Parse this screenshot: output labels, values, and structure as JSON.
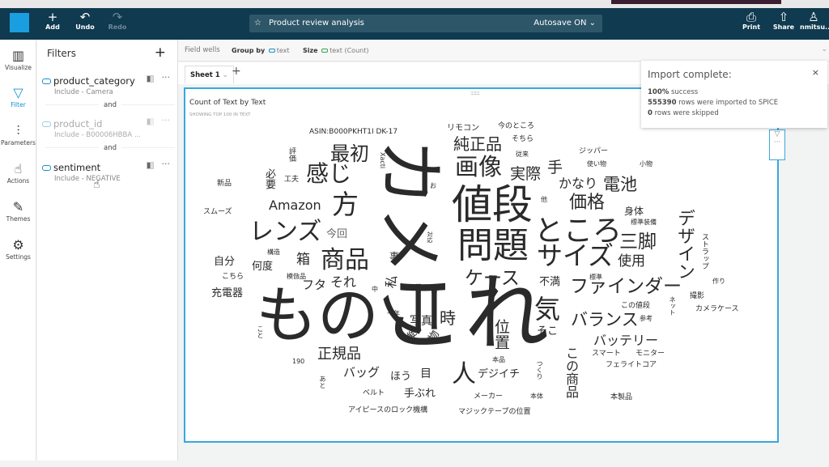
{
  "header": {
    "add": "Add",
    "undo": "Undo",
    "redo": "Redo",
    "title": "Product review analysis",
    "autosave": "Autosave ON",
    "print": "Print",
    "share": "Share",
    "user": "nmitsu..."
  },
  "rail": [
    {
      "label": "Visualize",
      "icon": "bar-chart-icon"
    },
    {
      "label": "Filter",
      "icon": "funnel-icon"
    },
    {
      "label": "Parameters",
      "icon": "sliders-icon"
    },
    {
      "label": "Actions",
      "icon": "pointer-gear-icon"
    },
    {
      "label": "Themes",
      "icon": "brush-icon"
    },
    {
      "label": "Settings",
      "icon": "gear-icon"
    }
  ],
  "filters": {
    "title": "Filters",
    "and": "and",
    "items": [
      {
        "name": "product_category",
        "sub": "Include - Camera"
      },
      {
        "name": "product_id",
        "sub": "Include - B00006HBBA ..."
      },
      {
        "name": "sentiment",
        "sub": "Include - NEGATIVE"
      }
    ]
  },
  "wells": {
    "label": "Field wells",
    "group_by": "Group by",
    "group_field": "text",
    "size": "Size",
    "size_field": "text (Count)"
  },
  "sheet": {
    "tab": "Sheet 1"
  },
  "visual": {
    "title": "Count of Text by Text",
    "subtitle": "SHOWING TOP 100 IN TEXT"
  },
  "toast": {
    "title": "Import complete:",
    "l1b": "100%",
    "l1": " success",
    "l2b": "555390",
    "l2": " rows were imported to SPICE",
    "l3b": "0",
    "l3": " rows were skipped"
  },
  "words": [
    "これ",
    "カメラ",
    "もの",
    "値段",
    "問題",
    "ところ",
    "サイズ",
    "商品",
    "レンズ",
    "方",
    "感じ",
    "気",
    "画像",
    "ケース",
    "人",
    "ファインダー",
    "最初",
    "三脚",
    "電池",
    "価格",
    "デザイン",
    "純正品",
    "実際",
    "手",
    "バランス",
    "時",
    "Amazon",
    "箱",
    "位置",
    "正規品",
    "バッテリー",
    "かなり",
    "使用",
    "この商品",
    "フタ",
    "それ",
    "私",
    "今回",
    "自分",
    "何度",
    "充電器",
    "不満",
    "写真",
    "後",
    "物",
    "そこ",
    "バッグ",
    "ほう",
    "目",
    "デジイチ",
    "手ぶれ",
    "身体",
    "必要",
    "事",
    "リモコン",
    "今のところ",
    "そちら",
    "従来",
    "ジッパー",
    "使い物",
    "小物",
    "他",
    "標準装備",
    "ストラップ",
    "ASIN:B000PKHT1I DK-17",
    "新品",
    "スムーズ",
    "工夫",
    "評価",
    "Xacti",
    "お",
    "対応",
    "構造",
    "こちら",
    "模倣品",
    "中",
    "一年",
    "標準",
    "作り",
    "撮影",
    "ネット",
    "この値段",
    "カメラケース",
    "参考",
    "こと",
    "190",
    "スマート",
    "モニター",
    "フェライトコア",
    "本品",
    "つくり",
    "あと",
    "ベルト",
    "メーカー",
    "本体",
    "本製品",
    "アイピースのロック機構",
    "マジックテープの位置"
  ]
}
